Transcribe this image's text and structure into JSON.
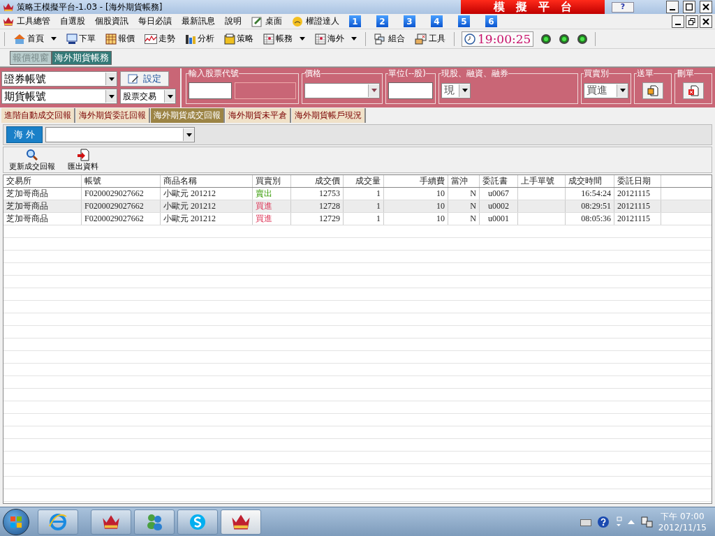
{
  "window": {
    "title": "策略王模擬平台-1.03 - [海外期貨帳務]",
    "banner": "模　擬　平　台",
    "help": "?"
  },
  "menu": [
    "工具總管",
    "自選股",
    "個股資訊",
    "每日必讀",
    "最新訊息",
    "說明",
    "桌面",
    "權證達人"
  ],
  "menu_numbers": [
    "1",
    "2",
    "3",
    "4",
    "5",
    "6"
  ],
  "toolbar": [
    {
      "label": "首頁",
      "dropdown": true
    },
    {
      "label": "下單",
      "dropdown": false
    },
    {
      "label": "報價",
      "dropdown": false
    },
    {
      "label": "走勢",
      "dropdown": false
    },
    {
      "label": "分析",
      "dropdown": false
    },
    {
      "label": "策略",
      "dropdown": false
    },
    {
      "label": "帳務",
      "dropdown": true
    },
    {
      "label": "海外",
      "dropdown": true
    },
    {
      "label": "組合",
      "dropdown": false
    },
    {
      "label": "工具",
      "dropdown": false
    }
  ],
  "clock": "19:00:25",
  "window_tabs": [
    {
      "label": "報價視窗",
      "selected": false
    },
    {
      "label": "海外期貨帳務",
      "selected": true
    }
  ],
  "order_panel": {
    "account_fields": [
      "證券帳號",
      "期貨帳號"
    ],
    "settings_button": "設定",
    "trade_type": "股票交易",
    "stock_code_label": "輸入股票代號",
    "price_label": "價格",
    "unit_label": "單位(--股)",
    "margin_label": "現股、融資、融券",
    "margin_value": "現",
    "side_label": "買賣別",
    "side_value": "買進",
    "send_label": "送單",
    "delete_label": "刪單"
  },
  "report_tabs": [
    {
      "label": "進階自動成交回報",
      "selected": false
    },
    {
      "label": "海外期貨委託回報",
      "selected": false
    },
    {
      "label": "海外期貨成交回報",
      "selected": true
    },
    {
      "label": "海外期貨未平倉",
      "selected": false
    },
    {
      "label": "海外期貨帳戶現況",
      "selected": false
    }
  ],
  "market_filter": {
    "label": "海 外"
  },
  "actions": [
    "更新成交回報",
    "匯出資料"
  ],
  "table": {
    "columns": [
      "交易所",
      "帳號",
      "商品名稱",
      "買賣別",
      "成交價",
      "成交量",
      "手續費",
      "當沖",
      "委託書",
      "上手單號",
      "成交時間",
      "委託日期"
    ],
    "rows": [
      {
        "cells": [
          "芝加哥商品",
          "F0200029027662",
          "小歐元 201212",
          "賣出",
          "12753",
          "1",
          "10",
          "N",
          "u0067",
          "",
          "16:54:24",
          "20121115"
        ],
        "kind": "sell",
        "selected": false
      },
      {
        "cells": [
          "芝加哥商品",
          "F0200029027662",
          "小歐元 201212",
          "買進",
          "12728",
          "1",
          "10",
          "N",
          "u0002",
          "",
          "08:29:51",
          "20121115"
        ],
        "kind": "buy",
        "selected": true
      },
      {
        "cells": [
          "芝加哥商品",
          "F0200029027662",
          "小歐元 201212",
          "買進",
          "12729",
          "1",
          "10",
          "N",
          "u0001",
          "",
          "08:05:36",
          "20121115"
        ],
        "kind": "buy",
        "selected": false
      }
    ]
  },
  "taskbar": {
    "time": "下午 07:00",
    "date": "2012/11/15"
  }
}
